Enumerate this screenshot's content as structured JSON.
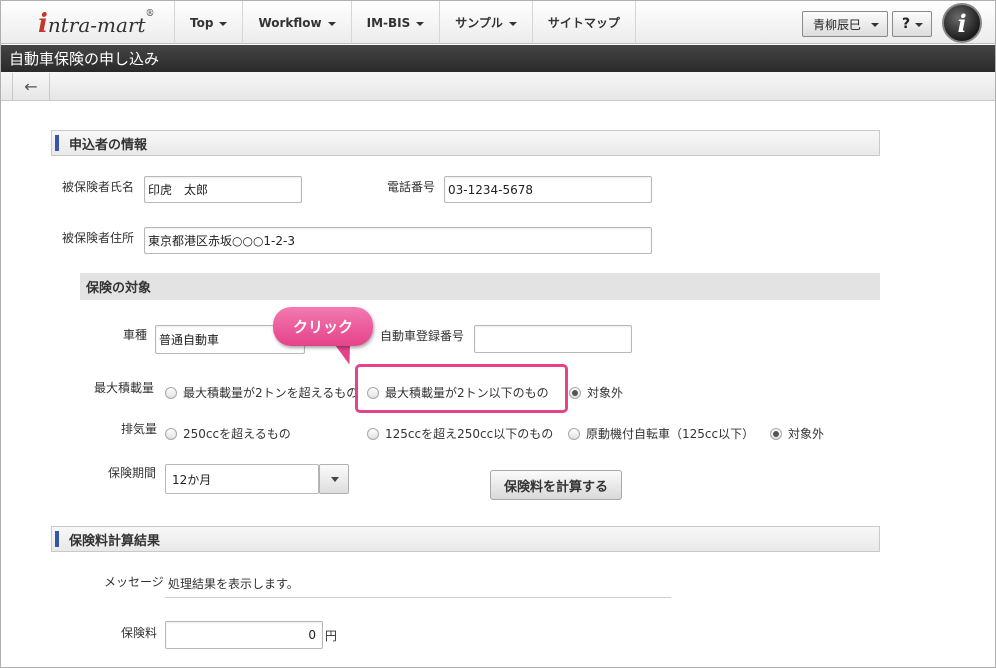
{
  "logo": {
    "first": "i",
    "rest": "ntra-mart",
    "mark": "®"
  },
  "nav": [
    {
      "label": "Top"
    },
    {
      "label": "Workflow"
    },
    {
      "label": "IM-BIS"
    },
    {
      "label": "サンプル"
    },
    {
      "label": "サイトマップ"
    }
  ],
  "user": {
    "name": "青柳辰巳"
  },
  "help_label": "?",
  "info_label": "i",
  "page_title": "自動車保険の申し込み",
  "toolbar": {
    "back_icon": "←"
  },
  "applicant": {
    "heading": "申込者の情報",
    "name_label": "被保険者氏名",
    "name_value": "印虎　太郎",
    "phone_label": "電話番号",
    "phone_value": "03-1234-5678",
    "address_label": "被保険者住所",
    "address_value": "東京都港区赤坂○○○1-2-3"
  },
  "target": {
    "heading": "保険の対象",
    "car_type_label": "車種",
    "car_type_value": "普通自動車",
    "reg_label": "自動車登録番号",
    "reg_value": "",
    "max_load_label": "最大積載量",
    "max_load_options": [
      "最大積載量が2トンを超えるもの",
      "最大積載量が2トン以下のもの",
      "対象外"
    ],
    "max_load_selected": "対象外",
    "exhaust_label": "排気量",
    "exhaust_options": [
      "250ccを超えるもの",
      "125ccを超え250cc以下のもの",
      "原動機付自転車（125cc以下）",
      "対象外"
    ],
    "exhaust_selected": "対象外",
    "period_label": "保険期間",
    "period_value": "12か月",
    "calc_button": "保険料を計算する"
  },
  "callout": {
    "text": "クリック",
    "color": "#e5428a"
  },
  "result": {
    "heading": "保険料計算結果",
    "message_label": "メッセージ",
    "message_value": "処理結果を表示します。",
    "fee_label": "保険料",
    "fee_value": "0",
    "fee_unit": "円"
  }
}
